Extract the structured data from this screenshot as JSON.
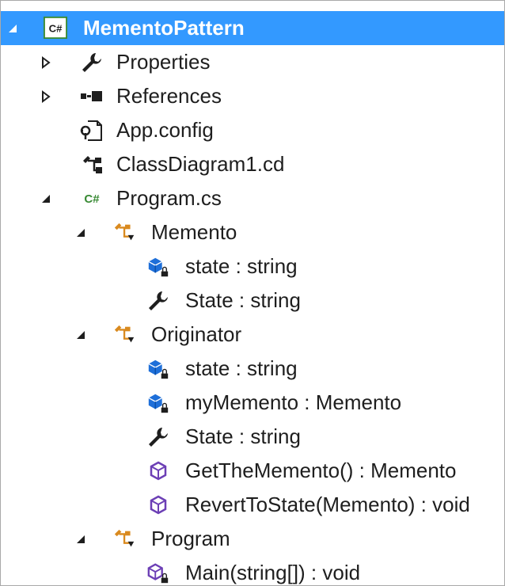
{
  "tree": {
    "project": {
      "label": "MementoPattern",
      "icon": "csharp-project-icon"
    },
    "properties": {
      "label": "Properties",
      "icon": "wrench-icon"
    },
    "references": {
      "label": "References",
      "icon": "references-icon"
    },
    "app_config": {
      "label": "App.config",
      "icon": "config-file-icon"
    },
    "class_diagram": {
      "label": "ClassDiagram1.cd",
      "icon": "class-diagram-icon"
    },
    "program_cs": {
      "label": "Program.cs",
      "icon": "csharp-file-icon"
    },
    "memento": {
      "label": "Memento",
      "icon": "class-icon",
      "members": [
        {
          "label": "state : string",
          "icon": "private-field-icon"
        },
        {
          "label": "State : string",
          "icon": "property-icon"
        }
      ]
    },
    "originator": {
      "label": "Originator",
      "icon": "class-icon",
      "members": [
        {
          "label": "state : string",
          "icon": "private-field-icon"
        },
        {
          "label": "myMemento : Memento",
          "icon": "private-field-icon"
        },
        {
          "label": "State : string",
          "icon": "property-icon"
        },
        {
          "label": "GetTheMemento() : Memento",
          "icon": "method-icon"
        },
        {
          "label": "RevertToState(Memento) : void",
          "icon": "method-icon"
        }
      ]
    },
    "program": {
      "label": "Program",
      "icon": "class-icon",
      "members": [
        {
          "label": "Main(string[]) : void",
          "icon": "private-method-icon"
        }
      ]
    }
  },
  "colors": {
    "selection": "#3399ff",
    "field_blue": "#1e6fd9",
    "method_purple": "#6c3fb5",
    "class_orange": "#d98a1f",
    "csharp_green": "#388a34"
  }
}
